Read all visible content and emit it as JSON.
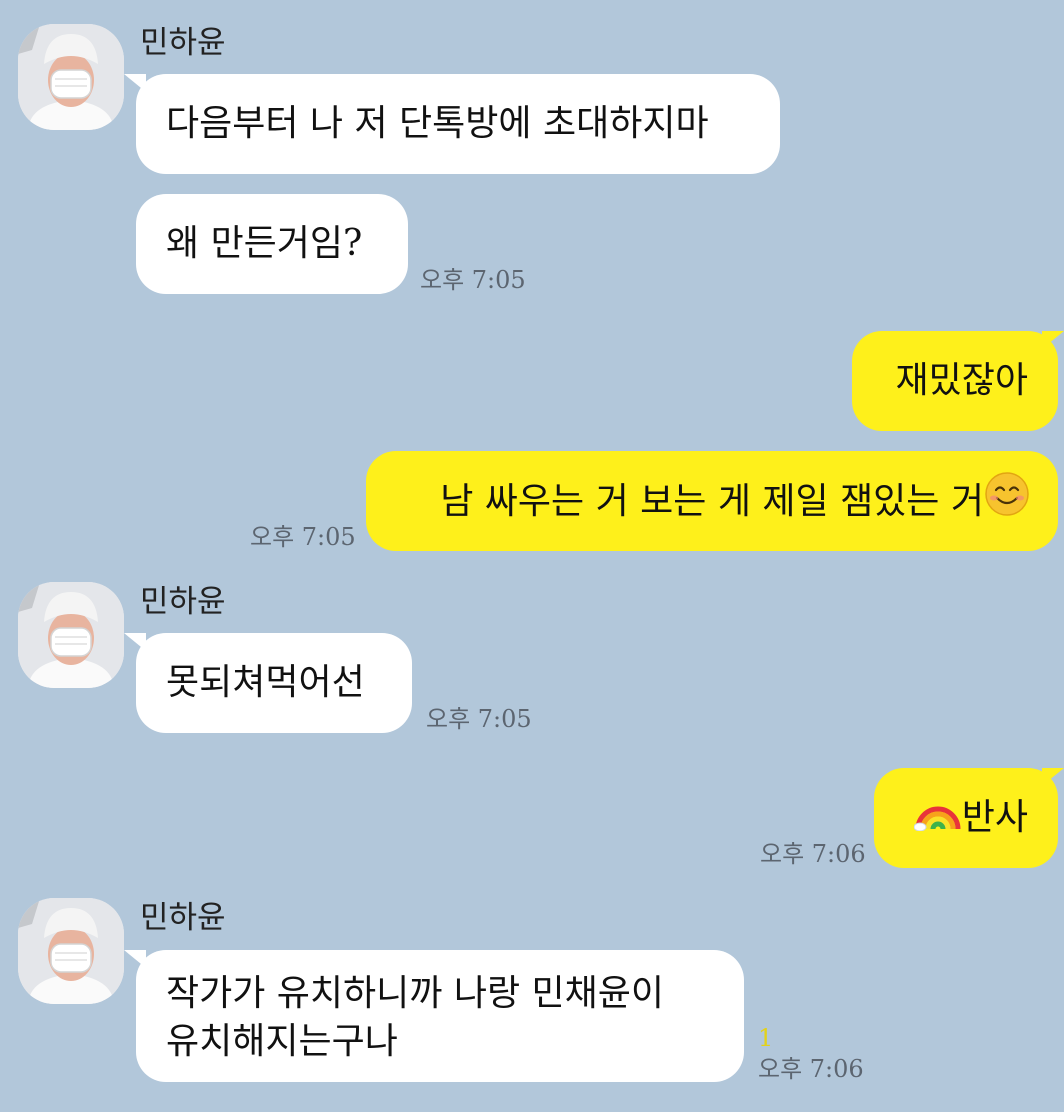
{
  "messages": [
    {
      "sender": "민하윤",
      "lines": [
        "다음부터 나 저 단톡방에 초대하지마"
      ]
    },
    {
      "lines": [
        "왜 만든거임?"
      ],
      "time": "오후 7:05"
    },
    {
      "lines": [
        "재밌잖아"
      ]
    },
    {
      "lines": [
        "남 싸우는 거 보는 게 제일 잼있는 거"
      ],
      "emoji": "smiling-face-icon",
      "time": "오후 7:05"
    },
    {
      "sender": "민하윤",
      "lines": [
        "못되쳐먹어선"
      ],
      "time": "오후 7:05"
    },
    {
      "lines": [
        "반사"
      ],
      "emoji": "rainbow-icon",
      "time": "오후 7:06"
    },
    {
      "sender": "민하윤",
      "lines": [
        "작가가 유치하니까 나랑 민채윤이",
        "유치해지는구나"
      ],
      "unread": "1",
      "time": "오후 7:06"
    }
  ],
  "colors": {
    "background": "#b2c7da",
    "incoming_bubble": "#ffffff",
    "outgoing_bubble": "#fef01b",
    "unread_count": "#e3d21a"
  }
}
